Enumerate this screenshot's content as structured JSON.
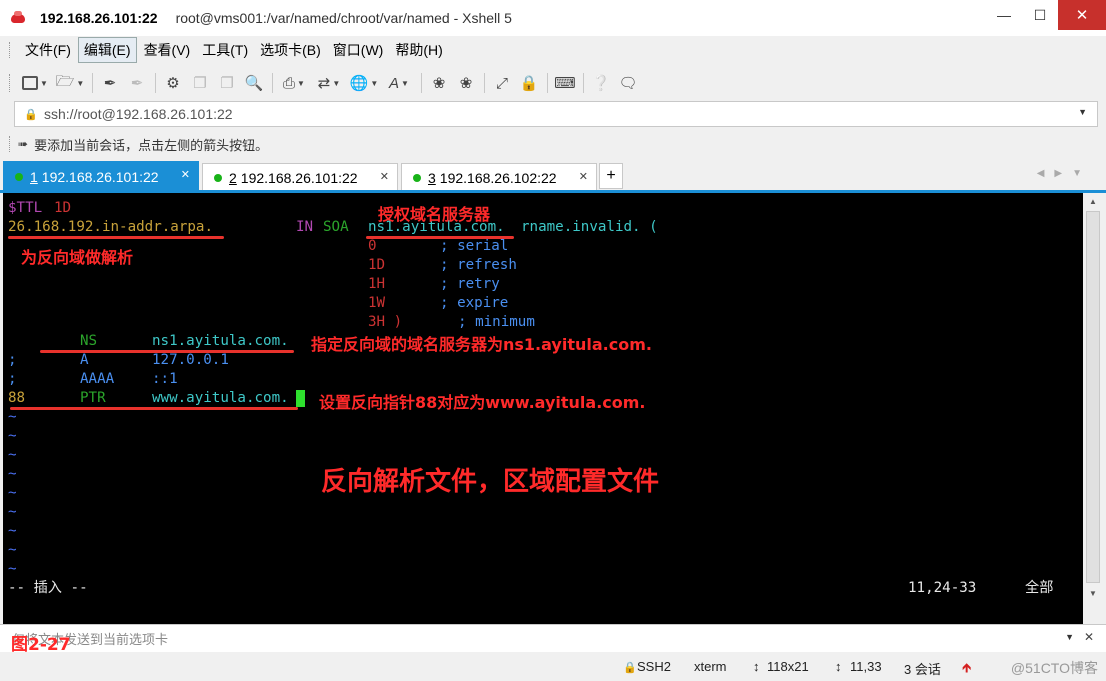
{
  "window": {
    "host": "192.168.26.101:22",
    "title_rest": "root@vms001:/var/named/chroot/var/named - Xshell 5"
  },
  "menu": [
    "文件(F)",
    "编辑(E)",
    "查看(V)",
    "工具(T)",
    "选项卡(B)",
    "窗口(W)",
    "帮助(H)"
  ],
  "address": {
    "url": "ssh://root@192.168.26.101:22"
  },
  "hint": {
    "text": "要添加当前会话，点击左侧的箭头按钮。"
  },
  "tabs": [
    {
      "num": "1",
      "label": "192.168.26.101:22",
      "active": true
    },
    {
      "num": "2",
      "label": "192.168.26.101:22",
      "active": false
    },
    {
      "num": "3",
      "label": "192.168.26.102:22",
      "active": false
    }
  ],
  "tab_add": "+",
  "terminal": {
    "ttl_kw": "$TTL",
    "ttl_val": "1D",
    "origin": "26.168.192.in-addr.arpa.",
    "soa_in": "IN",
    "soa_kw": "SOA",
    "soa_ns": "ns1.ayitula.com.",
    "soa_rname": "rname.invalid. (",
    "soa_rows": [
      {
        "val": "0",
        "comment": "; serial"
      },
      {
        "val": "1D",
        "comment": "; refresh"
      },
      {
        "val": "1H",
        "comment": "; retry"
      },
      {
        "val": "1W",
        "comment": "; expire"
      },
      {
        "val": "3H )",
        "comment": "; minimum"
      }
    ],
    "ns_type": "NS",
    "ns_val": "ns1.ayitula.com.",
    "a_semi": ";",
    "a_type": "A",
    "a_val": "127.0.0.1",
    "aaaa_semi": ";",
    "aaaa_type": "AAAA",
    "aaaa_val": "::1",
    "ptr_name": "88",
    "ptr_type": "PTR",
    "ptr_val": "www.ayitula.com.",
    "tilde": "~",
    "mode": "-- 插入 --",
    "position": "11,24-33",
    "scope": "全部"
  },
  "annotations": {
    "auth_ns": "授权域名服务器",
    "reverse_zone": "为反向域做解析",
    "ns_note": "指定反向域的域名服务器为ns1.ayitula.com.",
    "ptr_note": "设置反向指针88对应为www.ayitula.com.",
    "big_note": "反向解析文件，区域配置文件",
    "fig_label": "图2-27"
  },
  "compose": {
    "text": "仅将文本发送到当前选项卡"
  },
  "status": {
    "protocol": "SSH2",
    "term": "xterm",
    "size": "118x21",
    "cursor": "11,33",
    "sessions": "3 会话",
    "watermark": "@51CTO博客"
  },
  "colors": {
    "accent": "#1b8fd6",
    "annotation": "#ff2a2a",
    "terminal_bg": "#000000"
  }
}
